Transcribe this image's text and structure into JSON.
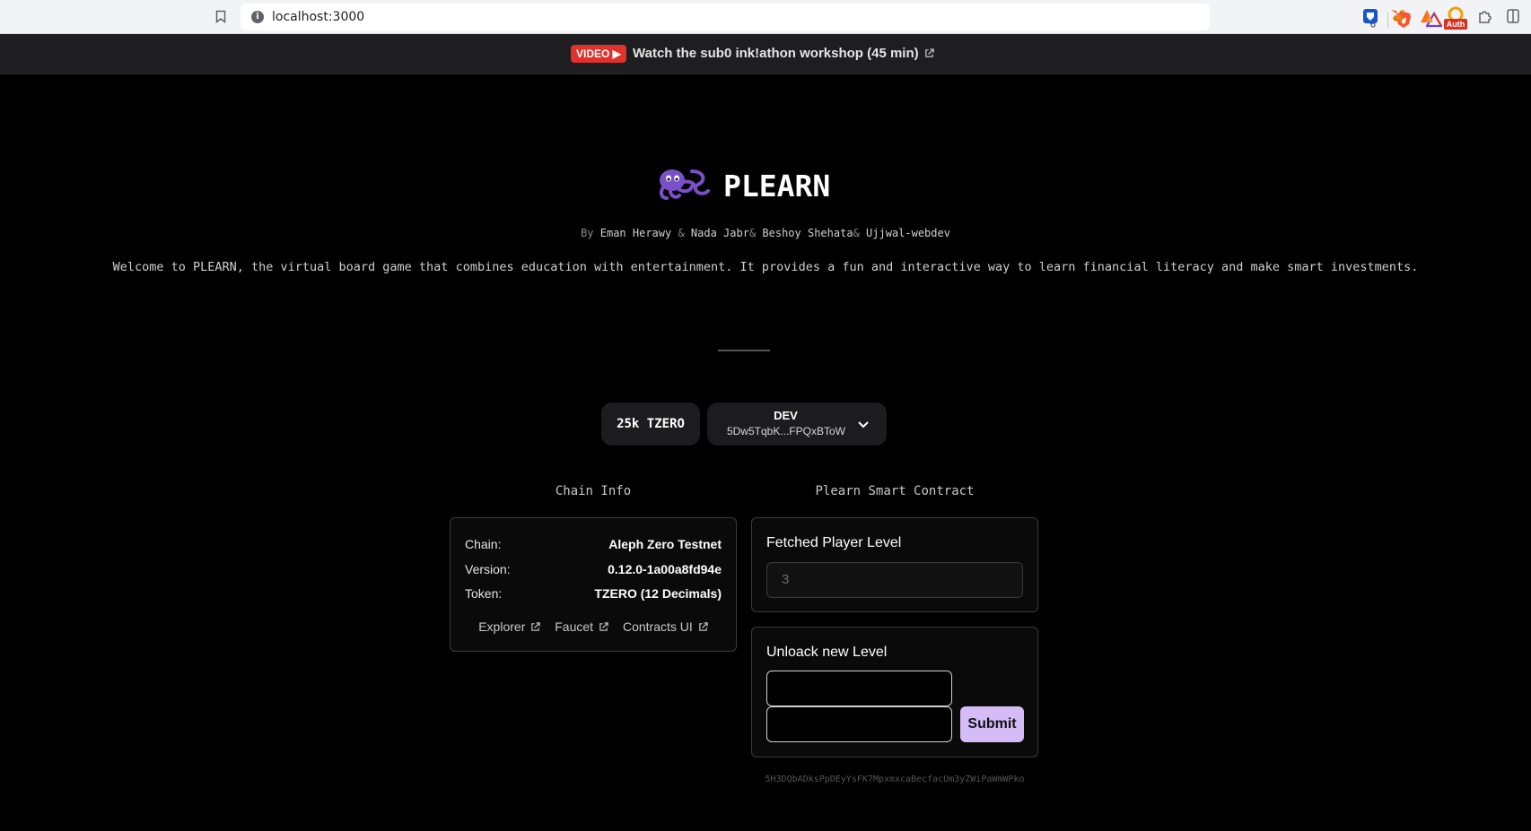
{
  "browser": {
    "url": "localhost:3000",
    "site_info_glyph": "i",
    "extension_badge": "Auth"
  },
  "banner": {
    "badge": "VIDEO ▶",
    "text": "Watch the sub0 ink!athon workshop (45 min)"
  },
  "header": {
    "title": "PLEARN",
    "by_prefix": "By",
    "authors": [
      "Eman Herawy",
      "Nada Jabr",
      "Beshoy Shehata",
      "Ujjwal-webdev"
    ],
    "separators": [
      " & ",
      "& ",
      "& "
    ],
    "welcome": "Welcome to PLEARN, the virtual board game that combines education with entertainment. It provides a fun and interactive way to learn financial literacy and make smart investments."
  },
  "account": {
    "balance": "25k TZERO",
    "name": "DEV",
    "address": "5Dw5TqbK...FPQxBToW"
  },
  "chain_info": {
    "heading": "Chain Info",
    "rows": [
      {
        "label": "Chain:",
        "value": "Aleph Zero Testnet"
      },
      {
        "label": "Version:",
        "value": "0.12.0-1a00a8fd94e"
      },
      {
        "label": "Token:",
        "value": "TZERO (12 Decimals)"
      }
    ],
    "links": [
      "Explorer",
      "Faucet",
      "Contracts UI"
    ]
  },
  "contract": {
    "heading": "Plearn Smart Contract",
    "fetched_title": "Fetched Player Level",
    "fetched_value": "3",
    "unlock_title": "Unloack new Level",
    "submit_label": "Submit",
    "address": "5H3DQbADksPpDEyYsFK7MpxmxcaBecfacUm3yZWiPaWmWPko"
  },
  "colors": {
    "background": "#000000",
    "banner_bg": "#1e1e21",
    "badge_red": "#e0312b",
    "submit_bg": "#d6bcf7",
    "logo_purple": "#7b4fc9"
  }
}
